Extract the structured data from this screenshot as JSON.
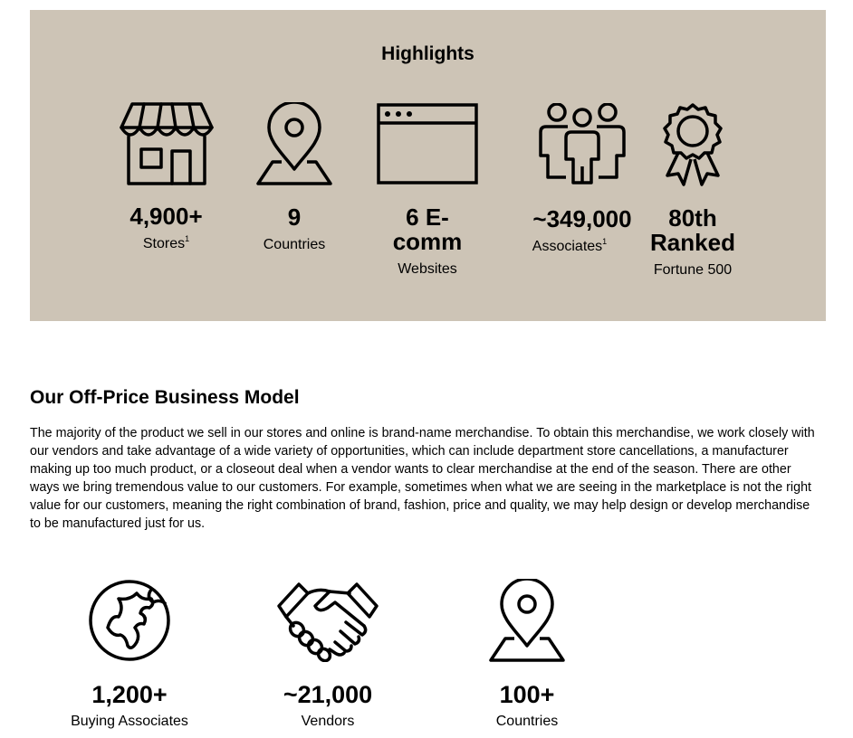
{
  "highlights": {
    "title": "Highlights",
    "stats": [
      {
        "icon": "storefront-icon",
        "value": "4,900+",
        "label": "Stores",
        "sup": "1"
      },
      {
        "icon": "map-pin-icon",
        "value": "9",
        "label": "Countries",
        "sup": ""
      },
      {
        "icon": "browser-window-icon",
        "value_line1": "6 E-",
        "value_line2": "comm",
        "label": "Websites",
        "sup": ""
      },
      {
        "icon": "people-group-icon",
        "value": "~349,000",
        "label": "Associates",
        "sup": "1"
      },
      {
        "icon": "award-ribbon-icon",
        "value_line1": "80th",
        "value_line2": "Ranked",
        "label": "Fortune 500",
        "sup": ""
      }
    ]
  },
  "business_model": {
    "title": "Our Off-Price Business Model",
    "paragraph": "The majority of the product we sell in our stores and online is brand-name merchandise. To obtain this merchandise, we work closely with our vendors and take advantage of a wide variety of opportunities, which can include department store cancellations, a manufacturer making up too much product, or a closeout deal when a vendor wants to clear merchandise at the end of the season. There are other ways we bring tremendous value to our customers. For example, sometimes when what we are seeing in the marketplace is not the right value for our customers, meaning the right combination of brand, fashion, price and quality, we may help design or develop merchandise to be manufactured just for us."
  },
  "bottom_stats": [
    {
      "icon": "globe-icon",
      "value": "1,200+",
      "label": "Buying Associates"
    },
    {
      "icon": "handshake-icon",
      "value": "~21,000",
      "label": "Vendors"
    },
    {
      "icon": "map-pin-icon",
      "value": "100+",
      "label": "Countries"
    }
  ],
  "colors": {
    "highlights_bg": "#cdc4b6",
    "text": "#000000"
  }
}
